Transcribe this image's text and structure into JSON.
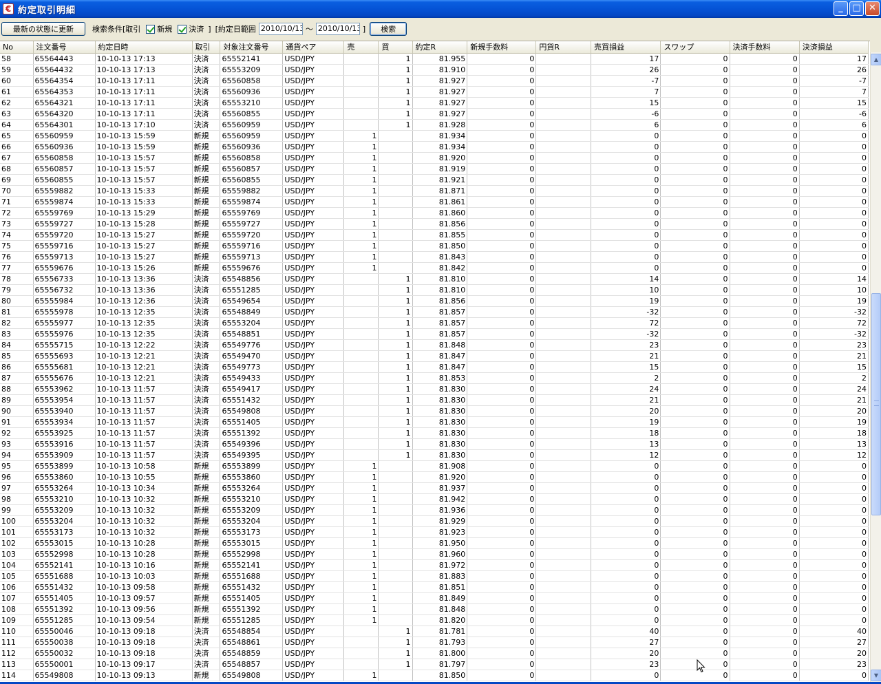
{
  "window": {
    "title": "約定取引明細",
    "min": "_",
    "max": "□",
    "close": "✕"
  },
  "toolbar": {
    "refresh_label": "最新の状態に更新",
    "search_cond_label": "検索条件[取引",
    "chk_new_label": "新規",
    "chk_settle_label": "決済",
    "bracket_close": "]",
    "date_range_label": "[約定日範囲",
    "date_from": "2010/10/13",
    "tilde": "〜",
    "date_to": "2010/10/13",
    "bracket_close2": "]",
    "search_label": "検索"
  },
  "columns": [
    "No",
    "注文番号",
    "約定日時",
    "取引",
    "対象注文番号",
    "通貨ペア",
    "売",
    "買",
    "約定R",
    "新規手数料",
    "円貨R",
    "売買損益",
    "スワップ",
    "決済手数料",
    "決済損益"
  ],
  "rows": [
    [
      "58",
      "65564443",
      "10-10-13 17:13",
      "決済",
      "65552141",
      "USD/JPY",
      "",
      "1",
      "81.955",
      "0",
      "",
      "17",
      "0",
      "0",
      "17"
    ],
    [
      "59",
      "65564432",
      "10-10-13 17:13",
      "決済",
      "65553209",
      "USD/JPY",
      "",
      "1",
      "81.910",
      "0",
      "",
      "26",
      "0",
      "0",
      "26"
    ],
    [
      "60",
      "65564354",
      "10-10-13 17:11",
      "決済",
      "65560858",
      "USD/JPY",
      "",
      "1",
      "81.927",
      "0",
      "",
      "-7",
      "0",
      "0",
      "-7"
    ],
    [
      "61",
      "65564353",
      "10-10-13 17:11",
      "決済",
      "65560936",
      "USD/JPY",
      "",
      "1",
      "81.927",
      "0",
      "",
      "7",
      "0",
      "0",
      "7"
    ],
    [
      "62",
      "65564321",
      "10-10-13 17:11",
      "決済",
      "65553210",
      "USD/JPY",
      "",
      "1",
      "81.927",
      "0",
      "",
      "15",
      "0",
      "0",
      "15"
    ],
    [
      "63",
      "65564320",
      "10-10-13 17:11",
      "決済",
      "65560855",
      "USD/JPY",
      "",
      "1",
      "81.927",
      "0",
      "",
      "-6",
      "0",
      "0",
      "-6"
    ],
    [
      "64",
      "65564301",
      "10-10-13 17:10",
      "決済",
      "65560959",
      "USD/JPY",
      "",
      "1",
      "81.928",
      "0",
      "",
      "6",
      "0",
      "0",
      "6"
    ],
    [
      "65",
      "65560959",
      "10-10-13 15:59",
      "新規",
      "65560959",
      "USD/JPY",
      "1",
      "",
      "81.934",
      "0",
      "",
      "0",
      "0",
      "0",
      "0"
    ],
    [
      "66",
      "65560936",
      "10-10-13 15:59",
      "新規",
      "65560936",
      "USD/JPY",
      "1",
      "",
      "81.934",
      "0",
      "",
      "0",
      "0",
      "0",
      "0"
    ],
    [
      "67",
      "65560858",
      "10-10-13 15:57",
      "新規",
      "65560858",
      "USD/JPY",
      "1",
      "",
      "81.920",
      "0",
      "",
      "0",
      "0",
      "0",
      "0"
    ],
    [
      "68",
      "65560857",
      "10-10-13 15:57",
      "新規",
      "65560857",
      "USD/JPY",
      "1",
      "",
      "81.919",
      "0",
      "",
      "0",
      "0",
      "0",
      "0"
    ],
    [
      "69",
      "65560855",
      "10-10-13 15:57",
      "新規",
      "65560855",
      "USD/JPY",
      "1",
      "",
      "81.921",
      "0",
      "",
      "0",
      "0",
      "0",
      "0"
    ],
    [
      "70",
      "65559882",
      "10-10-13 15:33",
      "新規",
      "65559882",
      "USD/JPY",
      "1",
      "",
      "81.871",
      "0",
      "",
      "0",
      "0",
      "0",
      "0"
    ],
    [
      "71",
      "65559874",
      "10-10-13 15:33",
      "新規",
      "65559874",
      "USD/JPY",
      "1",
      "",
      "81.861",
      "0",
      "",
      "0",
      "0",
      "0",
      "0"
    ],
    [
      "72",
      "65559769",
      "10-10-13 15:29",
      "新規",
      "65559769",
      "USD/JPY",
      "1",
      "",
      "81.860",
      "0",
      "",
      "0",
      "0",
      "0",
      "0"
    ],
    [
      "73",
      "65559727",
      "10-10-13 15:28",
      "新規",
      "65559727",
      "USD/JPY",
      "1",
      "",
      "81.856",
      "0",
      "",
      "0",
      "0",
      "0",
      "0"
    ],
    [
      "74",
      "65559720",
      "10-10-13 15:27",
      "新規",
      "65559720",
      "USD/JPY",
      "1",
      "",
      "81.855",
      "0",
      "",
      "0",
      "0",
      "0",
      "0"
    ],
    [
      "75",
      "65559716",
      "10-10-13 15:27",
      "新規",
      "65559716",
      "USD/JPY",
      "1",
      "",
      "81.850",
      "0",
      "",
      "0",
      "0",
      "0",
      "0"
    ],
    [
      "76",
      "65559713",
      "10-10-13 15:27",
      "新規",
      "65559713",
      "USD/JPY",
      "1",
      "",
      "81.843",
      "0",
      "",
      "0",
      "0",
      "0",
      "0"
    ],
    [
      "77",
      "65559676",
      "10-10-13 15:26",
      "新規",
      "65559676",
      "USD/JPY",
      "1",
      "",
      "81.842",
      "0",
      "",
      "0",
      "0",
      "0",
      "0"
    ],
    [
      "78",
      "65556733",
      "10-10-13 13:36",
      "決済",
      "65548856",
      "USD/JPY",
      "",
      "1",
      "81.810",
      "0",
      "",
      "14",
      "0",
      "0",
      "14"
    ],
    [
      "79",
      "65556732",
      "10-10-13 13:36",
      "決済",
      "65551285",
      "USD/JPY",
      "",
      "1",
      "81.810",
      "0",
      "",
      "10",
      "0",
      "0",
      "10"
    ],
    [
      "80",
      "65555984",
      "10-10-13 12:36",
      "決済",
      "65549654",
      "USD/JPY",
      "",
      "1",
      "81.856",
      "0",
      "",
      "19",
      "0",
      "0",
      "19"
    ],
    [
      "81",
      "65555978",
      "10-10-13 12:35",
      "決済",
      "65548849",
      "USD/JPY",
      "",
      "1",
      "81.857",
      "0",
      "",
      "-32",
      "0",
      "0",
      "-32"
    ],
    [
      "82",
      "65555977",
      "10-10-13 12:35",
      "決済",
      "65553204",
      "USD/JPY",
      "",
      "1",
      "81.857",
      "0",
      "",
      "72",
      "0",
      "0",
      "72"
    ],
    [
      "83",
      "65555976",
      "10-10-13 12:35",
      "決済",
      "65548851",
      "USD/JPY",
      "",
      "1",
      "81.857",
      "0",
      "",
      "-32",
      "0",
      "0",
      "-32"
    ],
    [
      "84",
      "65555715",
      "10-10-13 12:22",
      "決済",
      "65549776",
      "USD/JPY",
      "",
      "1",
      "81.848",
      "0",
      "",
      "23",
      "0",
      "0",
      "23"
    ],
    [
      "85",
      "65555693",
      "10-10-13 12:21",
      "決済",
      "65549470",
      "USD/JPY",
      "",
      "1",
      "81.847",
      "0",
      "",
      "21",
      "0",
      "0",
      "21"
    ],
    [
      "86",
      "65555681",
      "10-10-13 12:21",
      "決済",
      "65549773",
      "USD/JPY",
      "",
      "1",
      "81.847",
      "0",
      "",
      "15",
      "0",
      "0",
      "15"
    ],
    [
      "87",
      "65555676",
      "10-10-13 12:21",
      "決済",
      "65549433",
      "USD/JPY",
      "",
      "1",
      "81.853",
      "0",
      "",
      "2",
      "0",
      "0",
      "2"
    ],
    [
      "88",
      "65553962",
      "10-10-13 11:57",
      "決済",
      "65549417",
      "USD/JPY",
      "",
      "1",
      "81.830",
      "0",
      "",
      "24",
      "0",
      "0",
      "24"
    ],
    [
      "89",
      "65553954",
      "10-10-13 11:57",
      "決済",
      "65551432",
      "USD/JPY",
      "",
      "1",
      "81.830",
      "0",
      "",
      "21",
      "0",
      "0",
      "21"
    ],
    [
      "90",
      "65553940",
      "10-10-13 11:57",
      "決済",
      "65549808",
      "USD/JPY",
      "",
      "1",
      "81.830",
      "0",
      "",
      "20",
      "0",
      "0",
      "20"
    ],
    [
      "91",
      "65553934",
      "10-10-13 11:57",
      "決済",
      "65551405",
      "USD/JPY",
      "",
      "1",
      "81.830",
      "0",
      "",
      "19",
      "0",
      "0",
      "19"
    ],
    [
      "92",
      "65553925",
      "10-10-13 11:57",
      "決済",
      "65551392",
      "USD/JPY",
      "",
      "1",
      "81.830",
      "0",
      "",
      "18",
      "0",
      "0",
      "18"
    ],
    [
      "93",
      "65553916",
      "10-10-13 11:57",
      "決済",
      "65549396",
      "USD/JPY",
      "",
      "1",
      "81.830",
      "0",
      "",
      "13",
      "0",
      "0",
      "13"
    ],
    [
      "94",
      "65553909",
      "10-10-13 11:57",
      "決済",
      "65549395",
      "USD/JPY",
      "",
      "1",
      "81.830",
      "0",
      "",
      "12",
      "0",
      "0",
      "12"
    ],
    [
      "95",
      "65553899",
      "10-10-13 10:58",
      "新規",
      "65553899",
      "USD/JPY",
      "1",
      "",
      "81.908",
      "0",
      "",
      "0",
      "0",
      "0",
      "0"
    ],
    [
      "96",
      "65553860",
      "10-10-13 10:55",
      "新規",
      "65553860",
      "USD/JPY",
      "1",
      "",
      "81.920",
      "0",
      "",
      "0",
      "0",
      "0",
      "0"
    ],
    [
      "97",
      "65553264",
      "10-10-13 10:34",
      "新規",
      "65553264",
      "USD/JPY",
      "1",
      "",
      "81.937",
      "0",
      "",
      "0",
      "0",
      "0",
      "0"
    ],
    [
      "98",
      "65553210",
      "10-10-13 10:32",
      "新規",
      "65553210",
      "USD/JPY",
      "1",
      "",
      "81.942",
      "0",
      "",
      "0",
      "0",
      "0",
      "0"
    ],
    [
      "99",
      "65553209",
      "10-10-13 10:32",
      "新規",
      "65553209",
      "USD/JPY",
      "1",
      "",
      "81.936",
      "0",
      "",
      "0",
      "0",
      "0",
      "0"
    ],
    [
      "100",
      "65553204",
      "10-10-13 10:32",
      "新規",
      "65553204",
      "USD/JPY",
      "1",
      "",
      "81.929",
      "0",
      "",
      "0",
      "0",
      "0",
      "0"
    ],
    [
      "101",
      "65553173",
      "10-10-13 10:32",
      "新規",
      "65553173",
      "USD/JPY",
      "1",
      "",
      "81.923",
      "0",
      "",
      "0",
      "0",
      "0",
      "0"
    ],
    [
      "102",
      "65553015",
      "10-10-13 10:28",
      "新規",
      "65553015",
      "USD/JPY",
      "1",
      "",
      "81.950",
      "0",
      "",
      "0",
      "0",
      "0",
      "0"
    ],
    [
      "103",
      "65552998",
      "10-10-13 10:28",
      "新規",
      "65552998",
      "USD/JPY",
      "1",
      "",
      "81.960",
      "0",
      "",
      "0",
      "0",
      "0",
      "0"
    ],
    [
      "104",
      "65552141",
      "10-10-13 10:16",
      "新規",
      "65552141",
      "USD/JPY",
      "1",
      "",
      "81.972",
      "0",
      "",
      "0",
      "0",
      "0",
      "0"
    ],
    [
      "105",
      "65551688",
      "10-10-13 10:03",
      "新規",
      "65551688",
      "USD/JPY",
      "1",
      "",
      "81.883",
      "0",
      "",
      "0",
      "0",
      "0",
      "0"
    ],
    [
      "106",
      "65551432",
      "10-10-13 09:58",
      "新規",
      "65551432",
      "USD/JPY",
      "1",
      "",
      "81.851",
      "0",
      "",
      "0",
      "0",
      "0",
      "0"
    ],
    [
      "107",
      "65551405",
      "10-10-13 09:57",
      "新規",
      "65551405",
      "USD/JPY",
      "1",
      "",
      "81.849",
      "0",
      "",
      "0",
      "0",
      "0",
      "0"
    ],
    [
      "108",
      "65551392",
      "10-10-13 09:56",
      "新規",
      "65551392",
      "USD/JPY",
      "1",
      "",
      "81.848",
      "0",
      "",
      "0",
      "0",
      "0",
      "0"
    ],
    [
      "109",
      "65551285",
      "10-10-13 09:54",
      "新規",
      "65551285",
      "USD/JPY",
      "1",
      "",
      "81.820",
      "0",
      "",
      "0",
      "0",
      "0",
      "0"
    ],
    [
      "110",
      "65550046",
      "10-10-13 09:18",
      "決済",
      "65548854",
      "USD/JPY",
      "",
      "1",
      "81.781",
      "0",
      "",
      "40",
      "0",
      "0",
      "40"
    ],
    [
      "111",
      "65550038",
      "10-10-13 09:18",
      "決済",
      "65548861",
      "USD/JPY",
      "",
      "1",
      "81.793",
      "0",
      "",
      "27",
      "0",
      "0",
      "27"
    ],
    [
      "112",
      "65550032",
      "10-10-13 09:18",
      "決済",
      "65548859",
      "USD/JPY",
      "",
      "1",
      "81.800",
      "0",
      "",
      "20",
      "0",
      "0",
      "20"
    ],
    [
      "113",
      "65550001",
      "10-10-13 09:17",
      "決済",
      "65548857",
      "USD/JPY",
      "",
      "1",
      "81.797",
      "0",
      "",
      "23",
      "0",
      "0",
      "23"
    ],
    [
      "114",
      "65549808",
      "10-10-13 09:13",
      "新規",
      "65549808",
      "USD/JPY",
      "1",
      "",
      "81.850",
      "0",
      "",
      "0",
      "0",
      "0",
      "0"
    ]
  ],
  "scrollbar": {
    "up": "▲",
    "down": "▼"
  }
}
